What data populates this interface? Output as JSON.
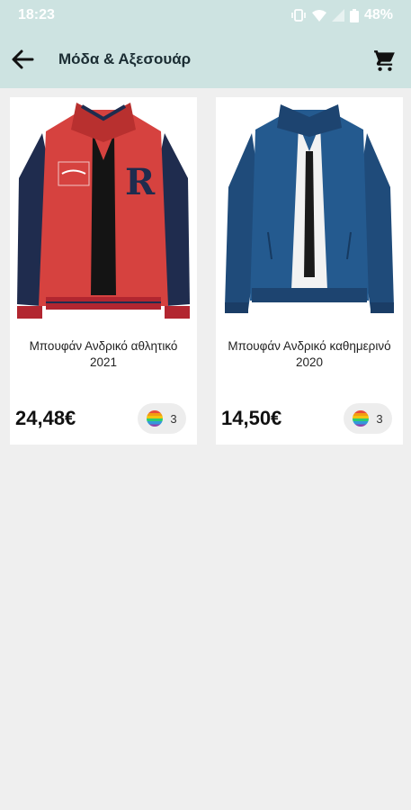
{
  "status": {
    "time": "18:23",
    "battery": "48%"
  },
  "appbar": {
    "title": "Μόδα & Αξεσουάρ"
  },
  "products": [
    {
      "name": "Μπουφάν Ανδρικό αθλητικό 2021",
      "price": "24,48€",
      "variants": "3"
    },
    {
      "name": "Μπουφάν Ανδρικό καθημερινό 2020",
      "price": "14,50€",
      "variants": "3"
    }
  ],
  "colors": {
    "appbar_bg": "#cde3e1",
    "page_bg": "#efefef"
  }
}
